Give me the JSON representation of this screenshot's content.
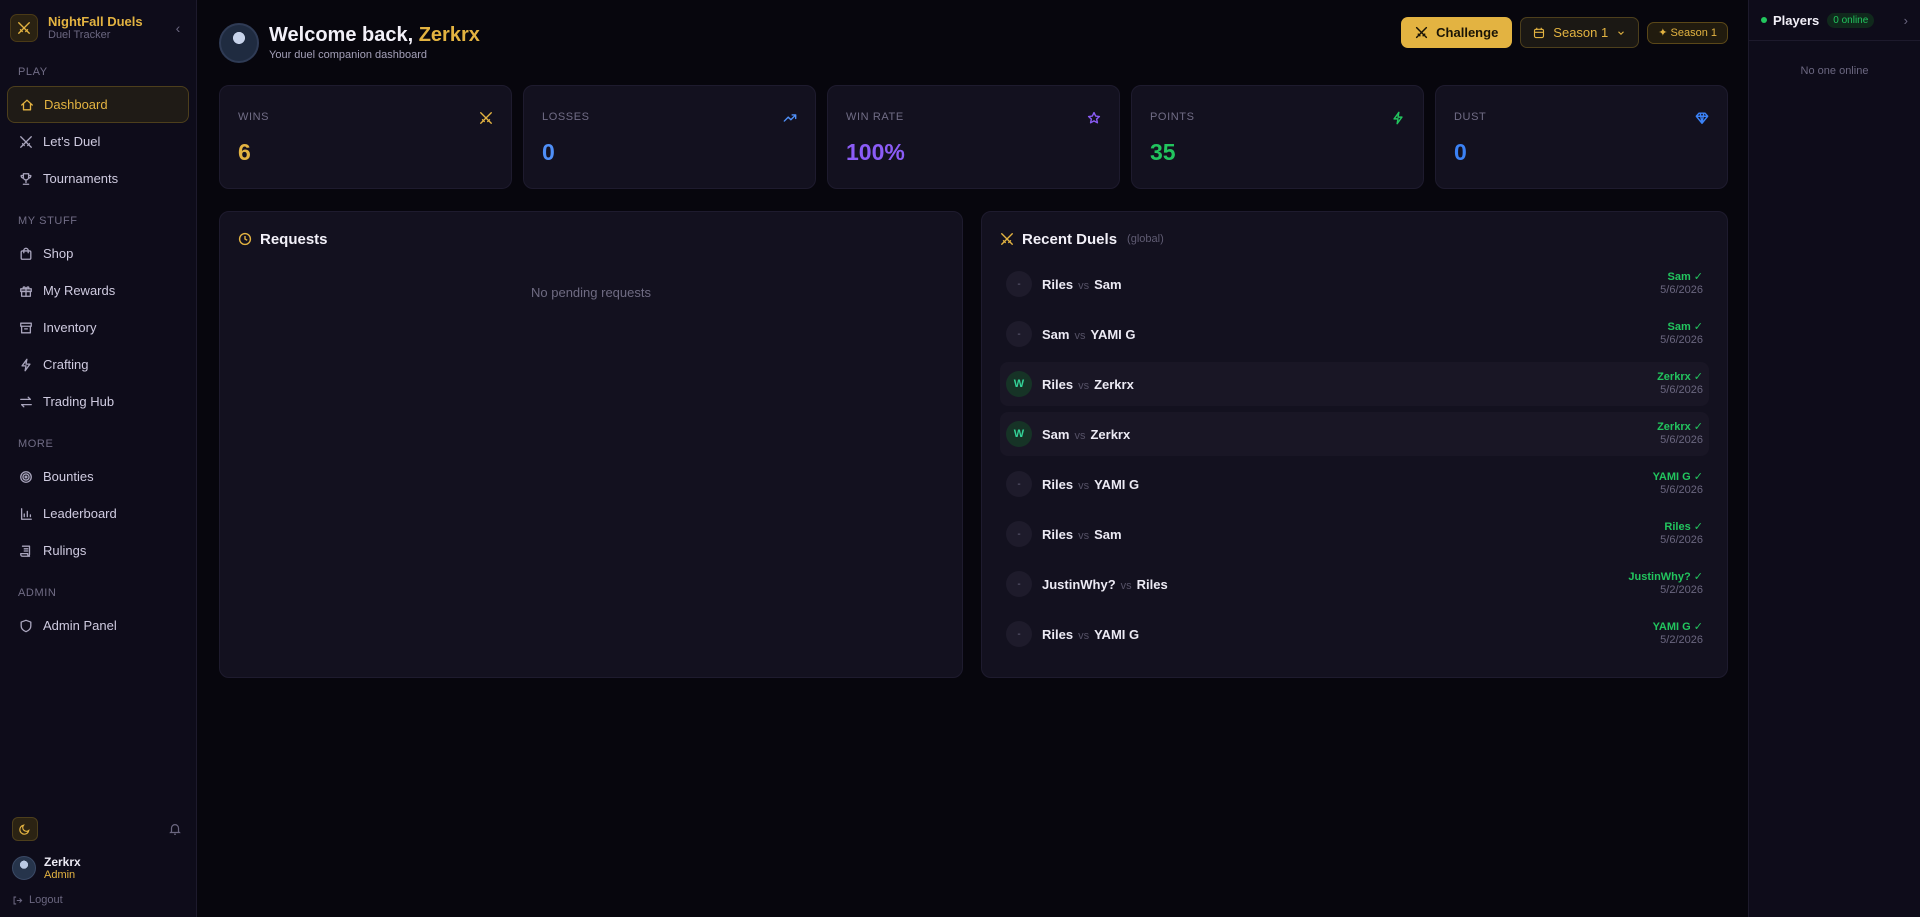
{
  "brand": {
    "name": "NightFall Duels",
    "subtitle": "Duel Tracker"
  },
  "nav": {
    "sections": [
      {
        "label": "PLAY",
        "items": [
          {
            "label": "Dashboard",
            "icon": "home-icon",
            "active": true
          },
          {
            "label": "Let's Duel",
            "icon": "swords-icon"
          },
          {
            "label": "Tournaments",
            "icon": "trophy-icon"
          }
        ]
      },
      {
        "label": "MY STUFF",
        "items": [
          {
            "label": "Shop",
            "icon": "shopping-bag-icon"
          },
          {
            "label": "My Rewards",
            "icon": "gift-icon"
          },
          {
            "label": "Inventory",
            "icon": "archive-icon"
          },
          {
            "label": "Crafting",
            "icon": "bolt-icon"
          },
          {
            "label": "Trading Hub",
            "icon": "swap-icon"
          }
        ]
      },
      {
        "label": "MORE",
        "items": [
          {
            "label": "Bounties",
            "icon": "target-icon"
          },
          {
            "label": "Leaderboard",
            "icon": "bar-chart-icon"
          },
          {
            "label": "Rulings",
            "icon": "scroll-icon"
          }
        ]
      },
      {
        "label": "ADMIN",
        "items": [
          {
            "label": "Admin Panel",
            "icon": "shield-icon"
          }
        ]
      }
    ]
  },
  "user": {
    "name": "Zerkrx",
    "role": "Admin",
    "logout_label": "Logout"
  },
  "header": {
    "welcome_prefix": "Welcome back, ",
    "username": "Zerkrx",
    "subtitle": "Your duel companion dashboard",
    "challenge_label": "Challenge",
    "season_select": "Season 1",
    "season_badge": "✦ Season 1"
  },
  "stats": [
    {
      "label": "WINS",
      "value": "6",
      "color": "#e3b341",
      "icon": "swords-icon"
    },
    {
      "label": "LOSSES",
      "value": "0",
      "color": "#4f8ff7",
      "icon": "trending-up-icon"
    },
    {
      "label": "WIN RATE",
      "value": "100%",
      "color": "#8b5cf6",
      "icon": "star-icon"
    },
    {
      "label": "POINTS",
      "value": "35",
      "color": "#22c55e",
      "icon": "bolt-icon"
    },
    {
      "label": "DUST",
      "value": "0",
      "color": "#3b82f6",
      "icon": "diamond-icon"
    }
  ],
  "requests": {
    "title": "Requests",
    "empty": "No pending requests"
  },
  "recent_duels": {
    "title": "Recent Duels",
    "hint": "(global)",
    "vs_label": "vs",
    "rows": [
      {
        "marker": "-",
        "p1": "Riles",
        "p2": "Sam",
        "winner": "Sam ✓",
        "date": "5/6/2026",
        "highlight": false
      },
      {
        "marker": "-",
        "p1": "Sam",
        "p2": "YAMI G",
        "winner": "Sam ✓",
        "date": "5/6/2026",
        "highlight": false
      },
      {
        "marker": "W",
        "p1": "Riles",
        "p2": "Zerkrx",
        "winner": "Zerkrx ✓",
        "date": "5/6/2026",
        "highlight": true
      },
      {
        "marker": "W",
        "p1": "Sam",
        "p2": "Zerkrx",
        "winner": "Zerkrx ✓",
        "date": "5/6/2026",
        "highlight": true
      },
      {
        "marker": "-",
        "p1": "Riles",
        "p2": "YAMI G",
        "winner": "YAMI G ✓",
        "date": "5/6/2026",
        "highlight": false
      },
      {
        "marker": "-",
        "p1": "Riles",
        "p2": "Sam",
        "winner": "Riles ✓",
        "date": "5/6/2026",
        "highlight": false
      },
      {
        "marker": "-",
        "p1": "JustinWhy?",
        "p2": "Riles",
        "winner": "JustinWhy? ✓",
        "date": "5/2/2026",
        "highlight": false
      },
      {
        "marker": "-",
        "p1": "Riles",
        "p2": "YAMI G",
        "winner": "YAMI G ✓",
        "date": "5/2/2026",
        "highlight": false
      }
    ]
  },
  "players": {
    "title": "Players",
    "online_badge": "0 online",
    "empty": "No one online"
  }
}
